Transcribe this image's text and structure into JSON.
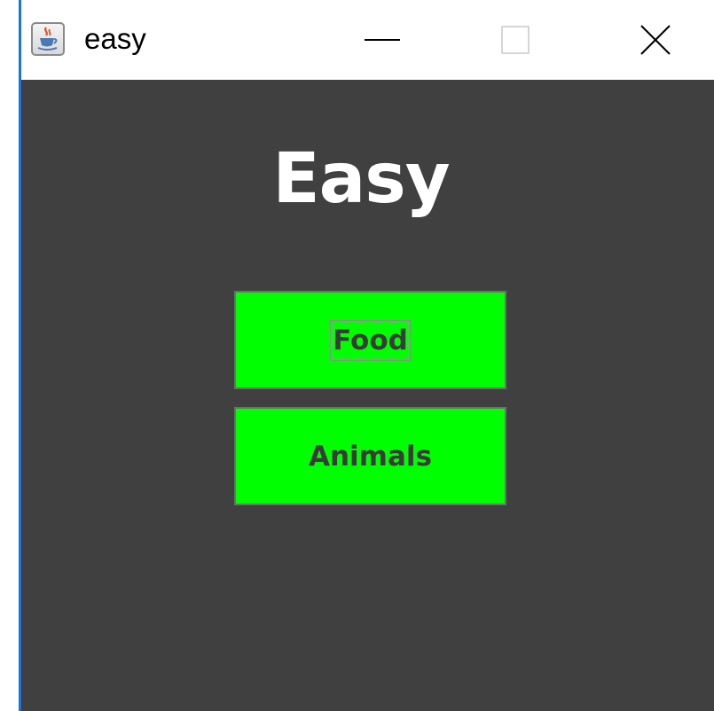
{
  "window": {
    "title": "easy",
    "icon": "java-cup-icon",
    "controls": {
      "minimize": "minimize-icon",
      "maximize": "maximize-icon",
      "close": "close-icon"
    }
  },
  "main": {
    "heading": "Easy",
    "buttons": [
      {
        "label": "Food",
        "focused": true
      },
      {
        "label": "Animals",
        "focused": false
      }
    ]
  },
  "colors": {
    "background": "#404040",
    "button": "#00ff00",
    "heading": "#ffffff",
    "button_text": "#3a3a3a",
    "window_border": "#1a73d8"
  }
}
